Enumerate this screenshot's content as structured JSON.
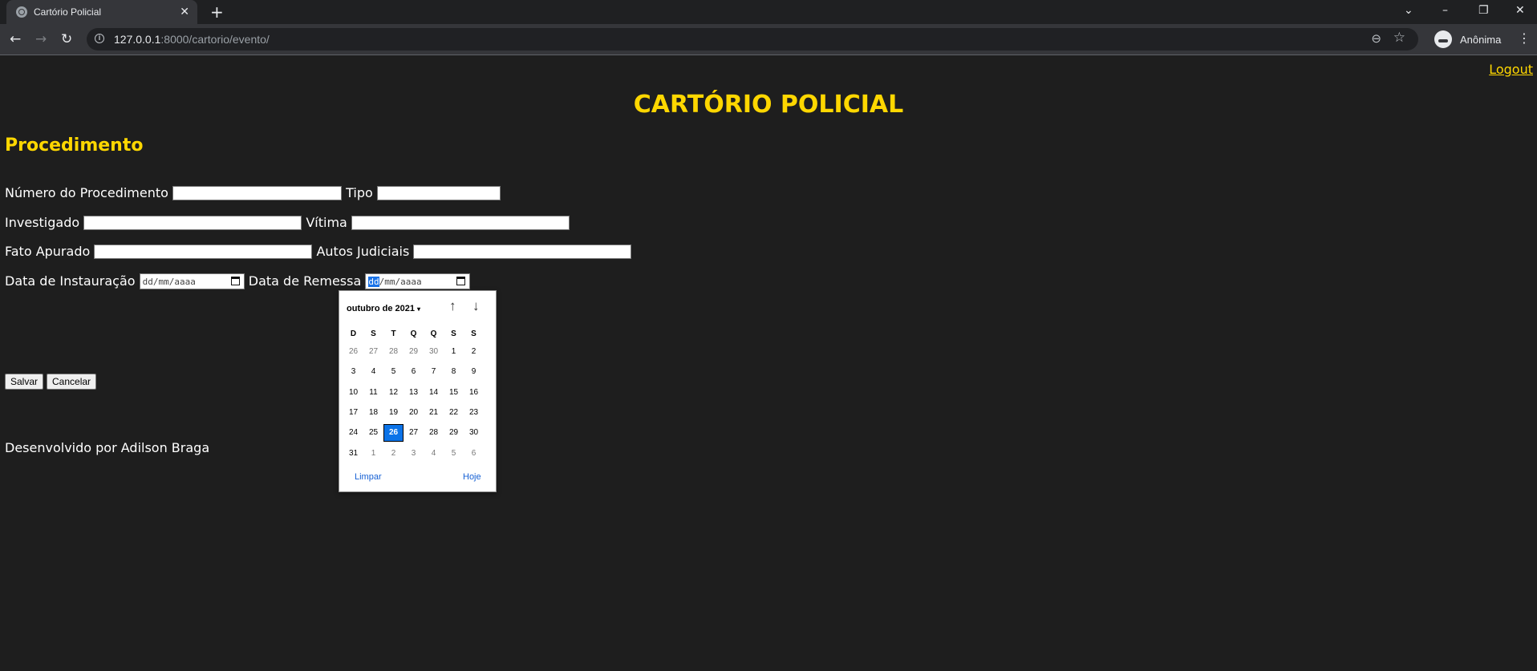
{
  "browser": {
    "tab_title": "Cartório Policial",
    "tab_close": "✕",
    "new_tab": "+",
    "url_host": "127.0.0.1",
    "url_path": ":8000/cartorio/evento/",
    "profile_label": "Anônima",
    "controls": {
      "back": "←",
      "forward": "→",
      "reload": "↻",
      "zoom": "⊖",
      "star": "☆",
      "menu": "⋮",
      "tab_search": "⌄",
      "minimize": "–",
      "restore": "❐",
      "close": "✕"
    }
  },
  "page": {
    "logout": "Logout",
    "site_title": "CARTÓRIO POLICIAL",
    "section_title": "Procedimento",
    "fields": {
      "numero": "Número do Procedimento",
      "tipo": "Tipo",
      "investigado": "Investigado",
      "vitima": "Vítima",
      "fato": "Fato Apurado",
      "autos": "Autos Judiciais",
      "instauracao": "Data de Instauração",
      "remessa": "Data de Remessa"
    },
    "date_placeholder": "dd/mm/aaaa",
    "date_remessa_dd": "dd",
    "date_remessa_rest": "/mm/aaaa",
    "buttons": {
      "save": "Salvar",
      "cancel": "Cancelar"
    },
    "footer": "Desenvolvido por Adilson Braga"
  },
  "datepicker": {
    "month_label": "outubro de 2021",
    "caret": "▾",
    "up": "↑",
    "down": "↓",
    "weekdays": [
      "D",
      "S",
      "T",
      "Q",
      "Q",
      "S",
      "S"
    ],
    "weeks": [
      [
        "26",
        "27",
        "28",
        "29",
        "30",
        "1",
        "2"
      ],
      [
        "3",
        "4",
        "5",
        "6",
        "7",
        "8",
        "9"
      ],
      [
        "10",
        "11",
        "12",
        "13",
        "14",
        "15",
        "16"
      ],
      [
        "17",
        "18",
        "19",
        "20",
        "21",
        "22",
        "23"
      ],
      [
        "24",
        "25",
        "26",
        "27",
        "28",
        "29",
        "30"
      ],
      [
        "31",
        "1",
        "2",
        "3",
        "4",
        "5",
        "6"
      ]
    ],
    "selected_day": "26",
    "clear": "Limpar",
    "today": "Hoje"
  },
  "colors": {
    "page_background": "#1e1e1e",
    "accent_yellow": "#ffd700",
    "selected_day": "#0b73e8"
  }
}
